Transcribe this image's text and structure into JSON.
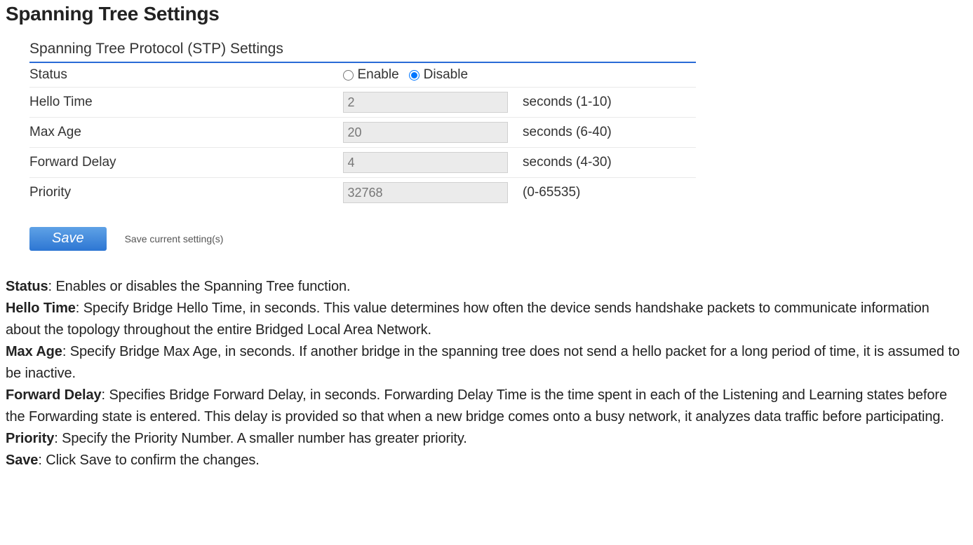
{
  "page_title": "Spanning Tree Settings",
  "panel_header": "Spanning Tree Protocol (STP) Settings",
  "fields": {
    "status": {
      "label": "Status",
      "options": {
        "enable": "Enable",
        "disable": "Disable"
      },
      "selected": "disable"
    },
    "hello_time": {
      "label": "Hello Time",
      "value": "2",
      "hint": "seconds (1-10)"
    },
    "max_age": {
      "label": "Max Age",
      "value": "20",
      "hint": "seconds (6-40)"
    },
    "fwd_delay": {
      "label": "Forward Delay",
      "value": "4",
      "hint": "seconds (4-30)"
    },
    "priority": {
      "label": "Priority",
      "value": "32768",
      "hint": "(0-65535)"
    }
  },
  "save": {
    "button": "Save",
    "hint": "Save current setting(s)"
  },
  "desc": {
    "status": {
      "term": "Status",
      "text": ": Enables or disables the Spanning Tree function."
    },
    "hello": {
      "term": "Hello Time",
      "text": ": Specify Bridge Hello Time, in seconds. This value determines how often the device sends handshake packets to communicate information about the topology throughout the entire Bridged Local Area Network."
    },
    "maxage": {
      "term": "Max Age",
      "text": ": Specify Bridge Max Age, in seconds. If another bridge in the spanning tree does not send a hello packet for a long period of time, it is assumed to be inactive."
    },
    "fwd": {
      "term": "Forward Delay",
      "text": ": Specifies Bridge Forward Delay, in seconds. Forwarding Delay Time is the time spent in each of the Listening and Learning states before the Forwarding state is entered. This delay is provided so that when a new bridge comes onto a busy network, it analyzes data traffic before participating."
    },
    "priority": {
      "term": "Priority",
      "text": ": Specify the Priority Number. A smaller number has greater priority."
    },
    "save": {
      "term": "Save",
      "text": ": Click Save to confirm the changes."
    }
  }
}
